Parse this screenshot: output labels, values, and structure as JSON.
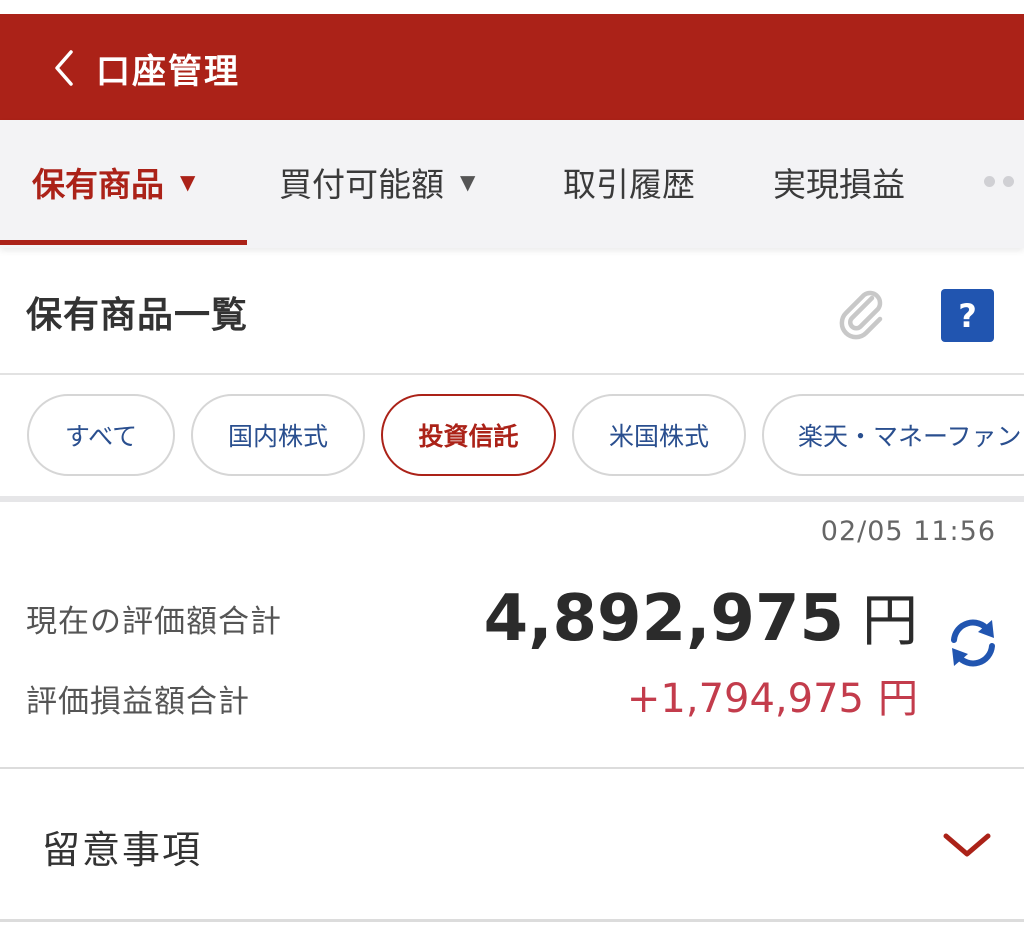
{
  "header": {
    "title": "口座管理"
  },
  "tabs": [
    {
      "label": "保有商品",
      "caret": "▼",
      "active": true
    },
    {
      "label": "買付可能額",
      "caret": "▼",
      "active": false
    },
    {
      "label": "取引履歴",
      "active": false
    },
    {
      "label": "実現損益",
      "active": false
    }
  ],
  "section": {
    "title": "保有商品一覧"
  },
  "filters": [
    {
      "label": "すべて",
      "active": false
    },
    {
      "label": "国内株式",
      "active": false
    },
    {
      "label": "投資信託",
      "active": true
    },
    {
      "label": "米国株式",
      "active": false
    },
    {
      "label": "楽天・マネーファン",
      "active": false
    }
  ],
  "summary": {
    "timestamp": "02/05 11:56",
    "total_label": "現在の評価額合計",
    "total_value": "4,892,975",
    "gain_label": "評価損益額合計",
    "gain_value": "+1,794,975",
    "currency": "円"
  },
  "notes": {
    "title": "留意事項"
  },
  "colors": {
    "brand_red": "#ab2218",
    "link_blue": "#2a4f8f",
    "help_blue": "#2155b0",
    "gain_red": "#c33c4c"
  },
  "icons": [
    "back-chevron-icon",
    "paperclip-icon",
    "help-icon",
    "refresh-icon",
    "chevron-down-icon"
  ]
}
